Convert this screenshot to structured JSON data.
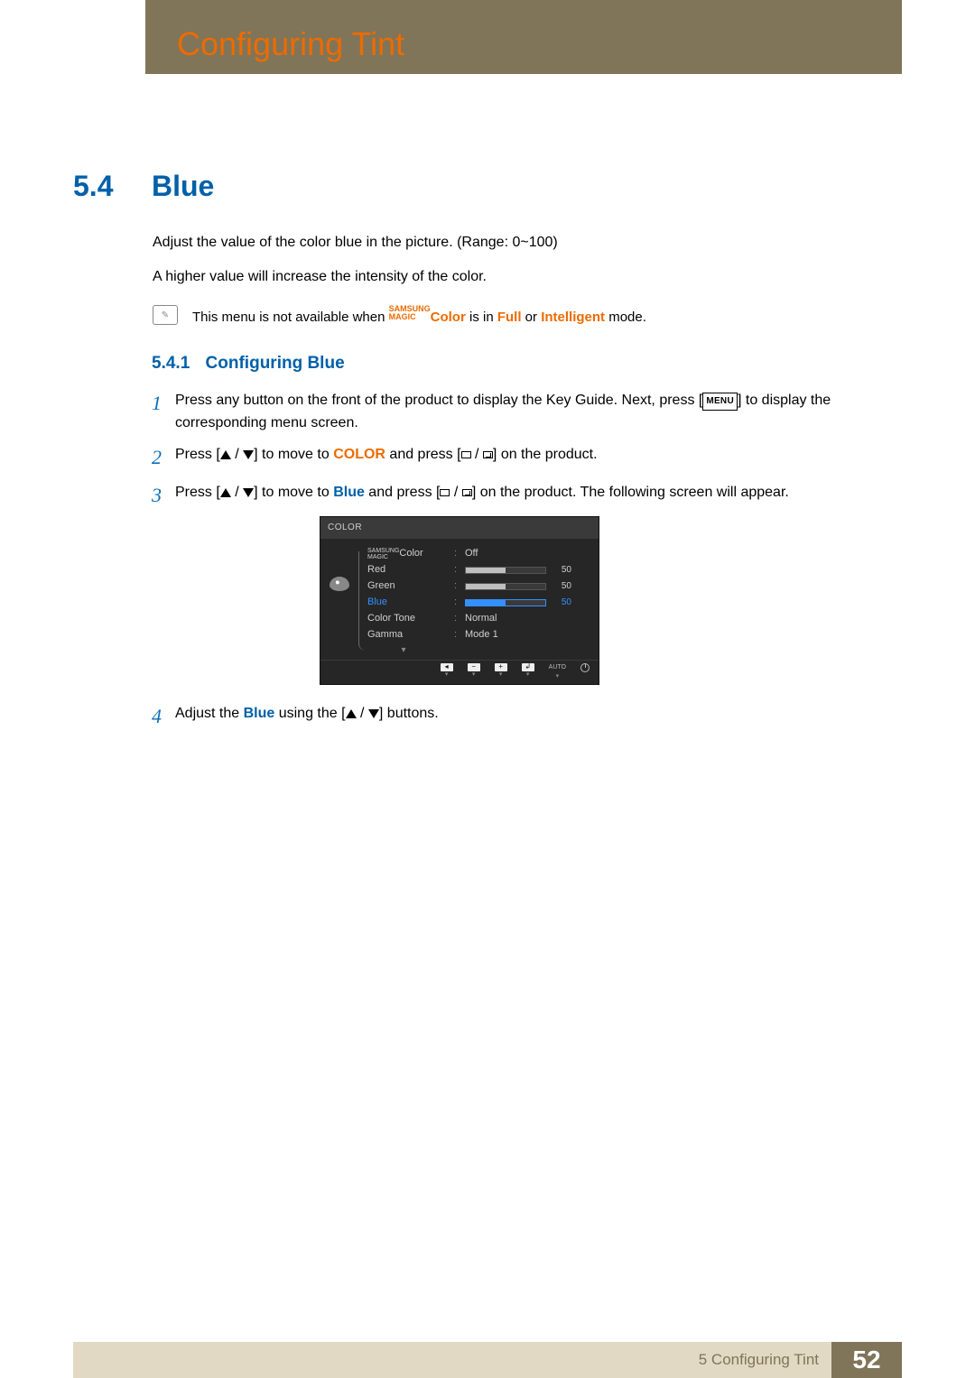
{
  "doc": {
    "header_title": "Configuring Tint"
  },
  "section": {
    "number": "5.4",
    "title": "Blue"
  },
  "intro": {
    "p1": "Adjust the value of the color blue in the picture. (Range: 0~100)",
    "p2": "A higher value will increase the intensity of the color."
  },
  "note": {
    "lead": "This menu is not available when ",
    "brand_top": "SAMSUNG",
    "brand_bot": "MAGIC",
    "colorword": "Color",
    "mid": " is in ",
    "full": "Full",
    "or": " or ",
    "intel": "Intelligent",
    "tail": " mode."
  },
  "subhead": {
    "num": "5.4.1",
    "title": "Configuring Blue"
  },
  "steps": {
    "s1a": "Press any button on the front of the product to display the Key Guide. Next, press [",
    "s1_menu": "MENU",
    "s1b": "] to display the corresponding menu screen.",
    "s2a": "Press [",
    "s2b": "] to move to ",
    "s2_color": "COLOR",
    "s2c": " and press [",
    "s2d": "] on the product.",
    "s3a": "Press [",
    "s3b": "] to move to ",
    "s3_blue": "Blue",
    "s3c": " and press [",
    "s3d": "] on the product. The following screen will appear.",
    "s4a": "Adjust the ",
    "s4_blue": "Blue",
    "s4b": " using the [",
    "s4c": "] buttons."
  },
  "osd": {
    "title": "COLOR",
    "magic_top": "SAMSUNG",
    "magic_bot": "MAGIC",
    "magic_label": " Color",
    "items": {
      "red": "Red",
      "green": "Green",
      "blue": "Blue",
      "tone": "Color Tone",
      "gamma": "Gamma"
    },
    "vals": {
      "off": "Off",
      "red": "50",
      "green": "50",
      "blue": "50",
      "tone": "Normal",
      "gamma": "Mode 1"
    },
    "foot": {
      "auto": "AUTO"
    }
  },
  "chart_data": {
    "type": "bar",
    "title": "COLOR",
    "categories": [
      "Red",
      "Green",
      "Blue"
    ],
    "values": [
      50,
      50,
      50
    ],
    "ylim": [
      0,
      100
    ],
    "selected": "Blue",
    "extra_settings": {
      "SAMSUNG MAGIC Color": "Off",
      "Color Tone": "Normal",
      "Gamma": "Mode 1"
    }
  },
  "footer": {
    "chapter": "5 Configuring Tint",
    "page": "52"
  }
}
